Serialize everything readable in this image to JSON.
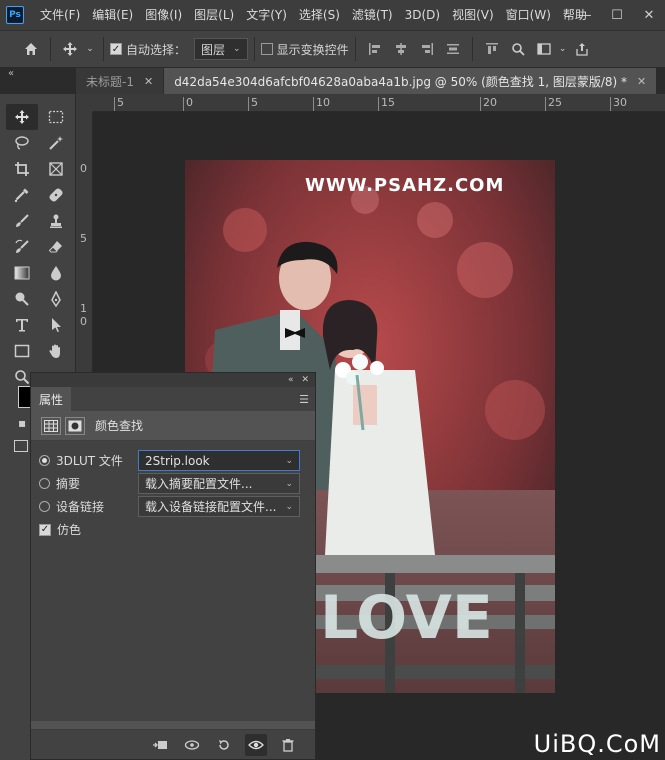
{
  "menubar": {
    "logo": "Ps",
    "items": [
      "文件(F)",
      "编辑(E)",
      "图像(I)",
      "图层(L)",
      "文字(Y)",
      "选择(S)",
      "滤镜(T)",
      "3D(D)",
      "视图(V)",
      "窗口(W)",
      "帮助"
    ],
    "min": "—",
    "max": "☐",
    "close": "✕"
  },
  "options": {
    "auto_select_label": "自动选择：",
    "auto_select_value": "图层",
    "show_transform_label": "显示变换控件"
  },
  "tabs": [
    {
      "label": "未标题-1",
      "close": "✕",
      "active": false
    },
    {
      "label": "d42da54e304d6afcbf04628a0aba4a1b.jpg @ 50% (颜色查找 1, 图层蒙版/8) *",
      "close": "✕",
      "active": true
    }
  ],
  "ruler_top": [
    "5",
    "0",
    "5",
    "10",
    "15",
    "20",
    "25",
    "30"
  ],
  "ruler_left": [
    "0",
    "5",
    "1",
    "0"
  ],
  "canvas": {
    "watermark": "WWW.PSAHZ.COM"
  },
  "properties": {
    "tab_label": "属性",
    "adjustment_title": "颜色查找",
    "rows": [
      {
        "label": "3DLUT 文件",
        "value": "2Strip.look",
        "selected": true
      },
      {
        "label": "摘要",
        "value": "载入摘要配置文件...",
        "selected": false
      },
      {
        "label": "设备链接",
        "value": "载入设备链接配置文件...",
        "selected": false
      }
    ],
    "dither_label": "仿色",
    "dither_checked": "✓"
  },
  "site_logo": "UiBQ.CoM",
  "icons": {
    "home": "home-icon",
    "move": "move-icon",
    "trash": "trash-icon",
    "eye": "eye-icon"
  }
}
